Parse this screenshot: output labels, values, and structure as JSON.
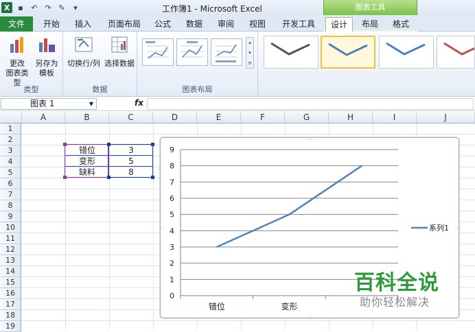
{
  "window": {
    "title": "工作簿1 - Microsoft Excel",
    "context_tab_header": "图表工具"
  },
  "tabs": [
    "文件",
    "开始",
    "插入",
    "页面布局",
    "公式",
    "数据",
    "审阅",
    "视图",
    "开发工具",
    "设计",
    "布局",
    "格式"
  ],
  "active_tab": "设计",
  "ribbon": {
    "groups": [
      {
        "label": "类型",
        "buttons": [
          {
            "label": "更改\n图表类型"
          },
          {
            "label": "另存为\n模板"
          }
        ]
      },
      {
        "label": "数据",
        "buttons": [
          {
            "label": "切换行/列"
          },
          {
            "label": "选择数据"
          }
        ]
      },
      {
        "label": "图表布局"
      }
    ]
  },
  "formula_bar": {
    "name_box": "图表 1",
    "fx": "fx",
    "formula": ""
  },
  "columns": [
    "A",
    "B",
    "C",
    "D",
    "E",
    "F",
    "G",
    "H",
    "I",
    "J"
  ],
  "rows": [
    "1",
    "2",
    "3",
    "4",
    "5",
    "6",
    "7",
    "8",
    "9",
    "10",
    "11",
    "12",
    "13",
    "14",
    "15",
    "16",
    "17",
    "18",
    "19"
  ],
  "table": [
    {
      "label": "错位",
      "value": "3"
    },
    {
      "label": "变形",
      "value": "5"
    },
    {
      "label": "缺料",
      "value": "8"
    }
  ],
  "chart_data": {
    "type": "line",
    "categories": [
      "错位",
      "变形",
      "缺料"
    ],
    "visible_x_labels": [
      "错位",
      "变形"
    ],
    "series": [
      {
        "name": "系列1",
        "values": [
          3,
          5,
          8
        ],
        "color": "#4f81bd"
      }
    ],
    "ylim": [
      0,
      9
    ],
    "yticks": [
      "0",
      "1",
      "2",
      "3",
      "4",
      "5",
      "6",
      "7",
      "8",
      "9"
    ],
    "grid": true,
    "legend": "right"
  },
  "watermark": {
    "line1": "百科全说",
    "line2": "助你轻松解决"
  },
  "colors": {
    "file_tab": "#2a8b3e",
    "context_tab": "#7cc24a",
    "series": "#4f81bd",
    "watermark": "#2f9a3a"
  }
}
